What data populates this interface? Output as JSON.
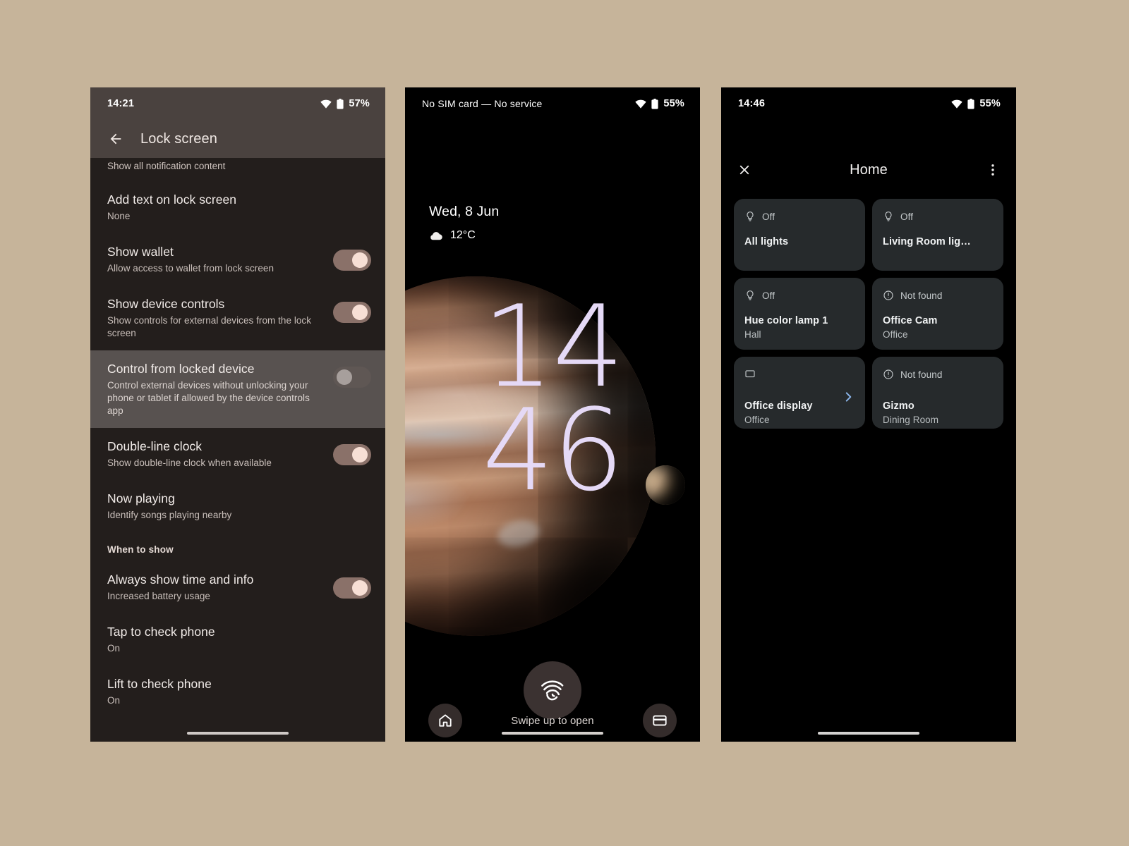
{
  "phones": {
    "settings": {
      "status": {
        "time": "14:21",
        "battery": "57%",
        "wifi_icon": "wifi-icon",
        "battery_icon": "battery-icon"
      },
      "appbar": {
        "title": "Lock screen",
        "back_icon": "back-arrow-icon"
      },
      "partial_row_sub": "Show all notification content",
      "rows": [
        {
          "title": "Add text on lock screen",
          "sub": "None",
          "toggle": null,
          "highlight": false
        },
        {
          "title": "Show wallet",
          "sub": "Allow access to wallet from lock screen",
          "toggle": "on",
          "highlight": false
        },
        {
          "title": "Show device controls",
          "sub": "Show controls for external devices from the lock screen",
          "toggle": "on",
          "highlight": false
        },
        {
          "title": "Control from locked device",
          "sub": "Control external devices without unlocking your phone or tablet if allowed by the device controls app",
          "toggle": "off",
          "highlight": true
        },
        {
          "title": "Double-line clock",
          "sub": "Show double-line clock when available",
          "toggle": "on",
          "highlight": false
        },
        {
          "title": "Now playing",
          "sub": "Identify songs playing nearby",
          "toggle": null,
          "highlight": false
        }
      ],
      "section_header": "When to show",
      "rows2": [
        {
          "title": "Always show time and info",
          "sub": "Increased battery usage",
          "toggle": "on",
          "highlight": false
        },
        {
          "title": "Tap to check phone",
          "sub": "On",
          "toggle": null,
          "highlight": false
        },
        {
          "title": "Lift to check phone",
          "sub": "On",
          "toggle": null,
          "highlight": false
        }
      ]
    },
    "lock": {
      "status": {
        "carrier": "No SIM card — No service",
        "battery": "55%",
        "wifi_icon": "wifi-icon",
        "battery_icon": "battery-icon"
      },
      "date": "Wed, 8 Jun",
      "weather": {
        "temp": "12°C",
        "icon": "cloud-icon"
      },
      "clock": {
        "line1": "14",
        "line2": "46",
        "color": "#e5d9f6"
      },
      "fingerprint_icon": "fingerprint-icon",
      "bottom": {
        "left_icon": "home-icon",
        "hint": "Swipe up to open",
        "right_icon": "wallet-icon"
      }
    },
    "home": {
      "status": {
        "time": "14:46",
        "battery": "55%",
        "wifi_icon": "wifi-icon",
        "battery_icon": "battery-icon"
      },
      "appbar": {
        "close_icon": "close-icon",
        "title": "Home",
        "overflow_icon": "kebab-menu-icon"
      },
      "controls": [
        {
          "status": "Off",
          "icon": "lightbulb-icon",
          "name": "All lights",
          "room": "",
          "chevron": false
        },
        {
          "status": "Off",
          "icon": "lightbulb-icon",
          "name": "Living Room lights",
          "room": "",
          "chevron": false
        },
        {
          "status": "Off",
          "icon": "lightbulb-icon",
          "name": "Hue color lamp 1",
          "room": "Hall",
          "chevron": false
        },
        {
          "status": "Not found",
          "icon": "error-icon",
          "name": "Office Cam",
          "room": "Office",
          "chevron": false
        },
        {
          "status": "",
          "icon": "display-icon",
          "name": "Office display",
          "room": "Office",
          "chevron": true
        },
        {
          "status": "Not found",
          "icon": "error-icon",
          "name": "Gizmo",
          "room": "Dining Room",
          "chevron": false
        }
      ]
    }
  },
  "colors": {
    "page_background": "#c6b49a",
    "settings_appbar": "#4a423f",
    "settings_body": "#231e1c",
    "settings_highlight": "#585250",
    "toggle_on_track": "#8a7169",
    "toggle_on_knob": "#f7dfd5",
    "toggle_off_track": "#5f5754",
    "toggle_off_knob": "#a79f9c",
    "card_background": "#262a2c",
    "chevron_blue": "#8ab4e8"
  }
}
